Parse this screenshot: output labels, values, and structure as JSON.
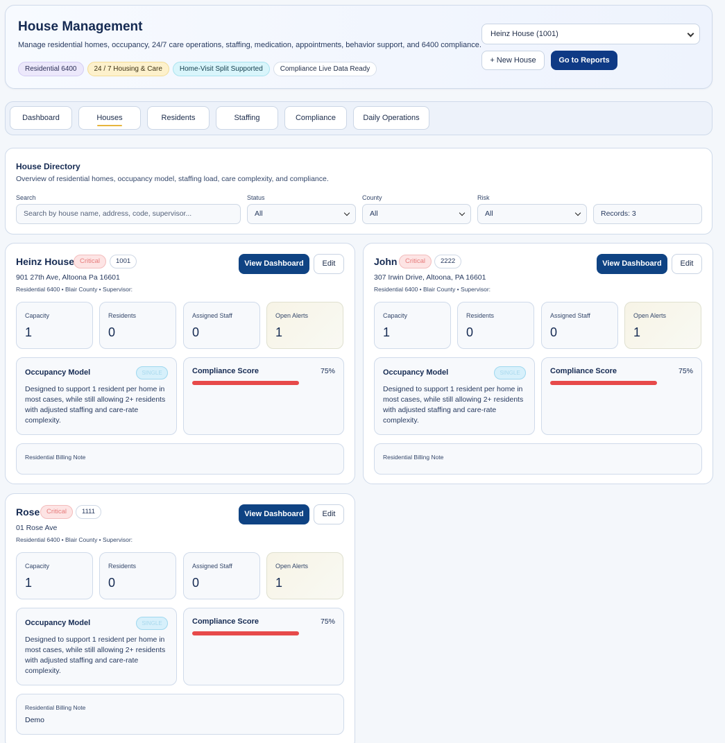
{
  "header": {
    "title": "House Management",
    "subtitle": "Manage residential homes, occupancy, 24/7 care operations, staffing, medication, appointments, behavior support, and 6400 compliance.",
    "chips": [
      "Residential 6400",
      "24 / 7 Housing & Care",
      "Home-Visit Split Supported",
      "Compliance Live Data Ready"
    ],
    "selected_house": "Heinz House (1001)",
    "new_house_label": "+ New House",
    "reports_label": "Go to Reports"
  },
  "tabs": [
    {
      "label": "Dashboard"
    },
    {
      "label": "Houses",
      "active": true
    },
    {
      "label": "Residents"
    },
    {
      "label": "Staffing"
    },
    {
      "label": "Compliance"
    },
    {
      "label": "Daily Operations"
    }
  ],
  "directory": {
    "title": "House Directory",
    "subtitle": "Overview of residential homes, occupancy model, staffing load, care complexity, and compliance.",
    "search_label": "Search",
    "search_placeholder": "Search by house name, address, code, supervisor...",
    "status_label": "Status",
    "status_value": "All",
    "county_label": "County",
    "county_value": "All",
    "risk_label": "Risk",
    "risk_value": "All",
    "records": "Records: 3"
  },
  "card_labels": {
    "view": "View Dashboard",
    "edit": "Edit",
    "capacity": "Capacity",
    "residents": "Residents",
    "assigned_staff": "Assigned Staff",
    "open_alerts": "Open Alerts",
    "occupancy_model": "Occupancy Model",
    "single": "SINGLE",
    "occupancy_text": "Designed to support 1 resident per home in most cases, while still allowing 2+ residents with adjusted staffing and care-rate complexity.",
    "compliance_score": "Compliance Score",
    "billing_note": "Residential Billing Note"
  },
  "houses": [
    {
      "name": "Heinz House",
      "risk": "Critical",
      "code": "1001",
      "address": "901 27th Ave, Altoona Pa 16601",
      "meta": "Residential 6400 • Blair County • Supervisor:",
      "capacity": "1",
      "residents": "0",
      "assigned_staff": "0",
      "open_alerts": "1",
      "compliance_pct": "75%",
      "compliance_value": 0.75,
      "billing_note": ""
    },
    {
      "name": "John",
      "risk": "Critical",
      "code": "2222",
      "address": "307 Irwin Drive, Altoona, PA 16601",
      "meta": "Residential 6400 • Blair County • Supervisor:",
      "capacity": "1",
      "residents": "0",
      "assigned_staff": "0",
      "open_alerts": "1",
      "compliance_pct": "75%",
      "compliance_value": 0.75,
      "billing_note": ""
    },
    {
      "name": "Rose",
      "risk": "Critical",
      "code": "1111",
      "address": "01 Rose Ave",
      "meta": "Residential 6400 • Blair County • Supervisor:",
      "capacity": "1",
      "residents": "0",
      "assigned_staff": "0",
      "open_alerts": "1",
      "compliance_pct": "75%",
      "compliance_value": 0.75,
      "billing_note": "Demo"
    }
  ]
}
